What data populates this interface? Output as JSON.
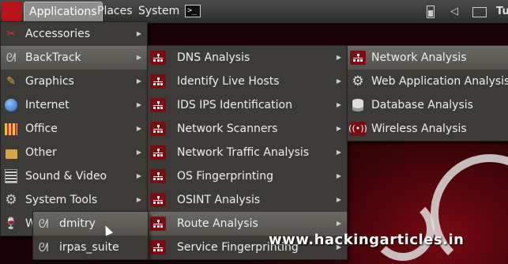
{
  "panel": {
    "applications": "Applications",
    "places": "Places",
    "system": "System",
    "terminal_glyph": ">_",
    "clock": "Tu"
  },
  "apps_menu": [
    {
      "label": "Accessories",
      "icon": "accessories-icon"
    },
    {
      "label": "BackTrack",
      "icon": "backtrack-dragon-icon"
    },
    {
      "label": "Graphics",
      "icon": "graphics-icon"
    },
    {
      "label": "Internet",
      "icon": "globe-icon"
    },
    {
      "label": "Office",
      "icon": "office-icon"
    },
    {
      "label": "Other",
      "icon": "other-icon"
    },
    {
      "label": "Sound & Video",
      "icon": "sound-video-icon"
    },
    {
      "label": "System Tools",
      "icon": "gear-icon"
    },
    {
      "label": "W",
      "icon": "wine-icon"
    }
  ],
  "backtrack_menu": [
    {
      "label": "DNS Analysis"
    },
    {
      "label": "Identify Live Hosts"
    },
    {
      "label": "IDS IPS Identification"
    },
    {
      "label": "Network Scanners"
    },
    {
      "label": "Network Traffic Analysis"
    },
    {
      "label": "OS Fingerprinting"
    },
    {
      "label": "OSINT Analysis"
    },
    {
      "label": "Route Analysis"
    },
    {
      "label": "Service Fingerprinting"
    }
  ],
  "recon_menu": [
    {
      "label": "Network Analysis",
      "icon": "network-icon"
    },
    {
      "label": "Web Application Analysis",
      "icon": "web-gear-icon"
    },
    {
      "label": "Database Analysis",
      "icon": "database-icon"
    },
    {
      "label": "Wireless Analysis",
      "icon": "wireless-icon"
    }
  ],
  "route_menu": [
    {
      "label": "dmitry"
    },
    {
      "label": "irpas_suite"
    }
  ],
  "watermark": "www.hackingarticles.in",
  "colors": {
    "menu_bg": "#3c3b37",
    "highlight": "#5e5c57",
    "brand_red": "#b8131a"
  }
}
